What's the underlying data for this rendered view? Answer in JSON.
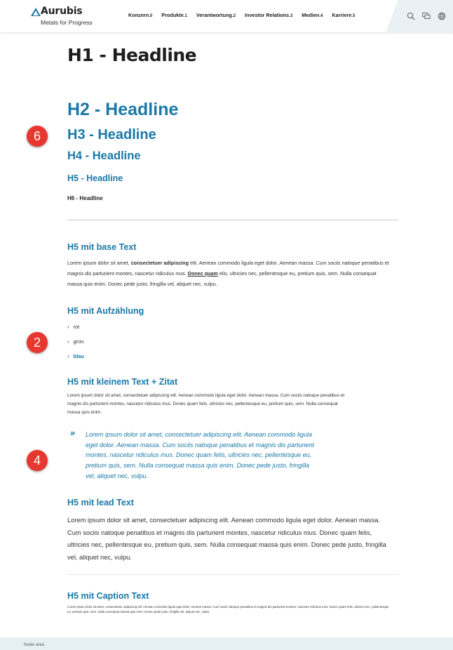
{
  "brand": {
    "name": "Aurubis",
    "tagline": "Metals for Progress",
    "color": "#1a79a8"
  },
  "nav": {
    "items": [
      {
        "label": "Konzern",
        "suffix": ".0"
      },
      {
        "label": "Produkte",
        "suffix": ".1"
      },
      {
        "label": "Verantwortung",
        "suffix": ".2"
      },
      {
        "label": "Investor Relations",
        "suffix": ".3"
      },
      {
        "label": "Medien",
        "suffix": ".4"
      },
      {
        "label": "Karriere",
        "suffix": ".5"
      }
    ]
  },
  "tools": [
    "search-icon",
    "chat-icon",
    "globe-icon"
  ],
  "headings": {
    "h1": "H1 - Headline",
    "h2": "H2 - Headline",
    "h3": "H3 - Headline",
    "h4": "H4 - Headline",
    "h5": "H5 - Headline",
    "h6": "H6 - Headline"
  },
  "sections": {
    "base": {
      "title": "H5 mit base Text",
      "text_1": "Lorem ipsum dolor sit amet, ",
      "text_bold": "consectetuer adipiscing",
      "text_2": " elit. Aenean commodo ligula eget dolor. ",
      "text_italic": "Aenean massa. Cum sociis natoque",
      "text_3": " penatibus et magnis dis parturient montes, nascetur ridiculus mus. ",
      "text_link": "Donec quam",
      "text_4": " elis, ultricies nec, pellentesque eu, pretium quis, sem. Nulla consequat massa quis enim. Donec pede justo, fringilla vel, aliquet nec, vulpu."
    },
    "list": {
      "title": "H5 mit Aufzählung",
      "items": [
        "rot",
        "grün",
        "blau"
      ]
    },
    "quote": {
      "title": "H5 mit kleinem Text + Zitat",
      "text": "Lorem ipsum dolor sit amet, consectetuer adipiscing elit. Aenean commodo ligula eget dolor. Aenean massa. Cum sociis natoque penatibus et magnis dis parturient montes, nascetur ridiculus mus. Donec quam felis, ultricies nec, pellentesque eu, pretium quis, sem. Nulla consequat massa quis enim.",
      "quote_mark": "»",
      "quote_text": "Lorem ipsum dolor sit amet, consectetuer adipiscing elit. Aenean commodo ligula eget dolor. Aenean massa. Cum sociis natoque penatibus et magnis dis parturient montes, nascetur ridiculus mus. Donec quam felis, ultricies nec, pellentesque eu, pretium quis, sem. Nulla consequat massa quis enim. Donec pede justo, fringilla vel, aliquet nec, vulpu."
    },
    "lead": {
      "title": "H5 mit lead Text",
      "text": "Lorem ipsum dolor sit amet, consectetuer adipiscing elit. Aenean commodo ligula eget dolor. Aenean massa. Cum sociis natoque penatibus et magnis dis parturient montes, nascetur ridiculus mus. Donec quam felis, ultricies nec, pellentesque eu, pretium quis, sem. Nulla consequat massa quis enim. Donec pede justo, fringilla vel, aliquet nec, vulpu."
    },
    "caption": {
      "title": "H5 mit Caption Text",
      "text": "Lorem ipsum dolor sit amet, consectetuer adipiscing elit. Aenean commodo ligula eget dolor. Aenean massa. Cum sociis natoque penatibus et magnis dis parturient montes, nascetur ridiculus mus. Donec quam felis, ultricies nec, pellentesque eu, pretium quis, sem. Nulla consequat massa quis enim. Donec pede justo, fringilla vel, aliquet nec, vulpu."
    }
  },
  "badges": {
    "top": "6",
    "middle": "2",
    "bottom": "4",
    "color": "#e8372f"
  },
  "footer": {
    "label": "footer area"
  }
}
